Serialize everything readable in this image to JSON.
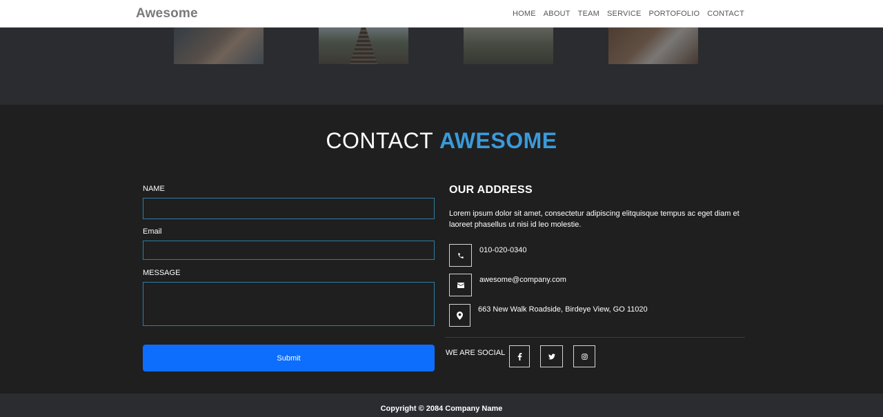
{
  "navbar": {
    "brand": "Awesome",
    "links": [
      "HOME",
      "ABOUT",
      "TEAM",
      "SERVICE",
      "PORTOFOLIO",
      "CONTACT"
    ]
  },
  "contact": {
    "title_light": "CONTACT",
    "title_accent": "AWESOME",
    "form": {
      "name_label": "NAME",
      "name_value": "",
      "email_label": "Email",
      "email_value": "",
      "message_label": "MESSAGE",
      "message_value": "",
      "submit_label": "Submit"
    },
    "address": {
      "title": "OUR ADDRESS",
      "text": "Lorem ipsum dolor sit amet, consectetur adipiscing elitquisque tempus ac eget diam et laoreet phasellus ut nisi id leo molestie.",
      "phone": "010-020-0340",
      "email": "awesome@company.com",
      "location": "663 New Walk Roadside, Birdeye View, GO 11020"
    },
    "social": {
      "label": "WE ARE SOCIAL",
      "icons": [
        "facebook-icon",
        "twitter-icon",
        "instagram-icon"
      ]
    }
  },
  "footer": {
    "copyright": "Copyright © 2084 Company Name"
  },
  "colors": {
    "accent": "#3a9ad9",
    "button": "#0d6efd",
    "section_bg": "#1f1f20",
    "band_bg": "#2b2c30"
  }
}
